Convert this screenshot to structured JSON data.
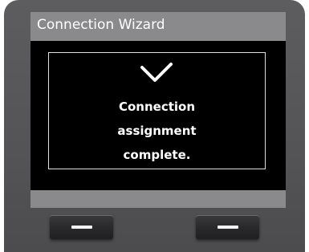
{
  "header": {
    "title": "Connection Wizard"
  },
  "message": {
    "icon": "checkmark-icon",
    "lines": [
      "Connection",
      "assignment",
      "complete."
    ]
  },
  "softkeys": {
    "left_icon": "dash-icon",
    "right_icon": "dash-icon"
  },
  "colors": {
    "housing": "#545456",
    "screen_chrome": "#8a8a8c",
    "content_bg": "#000000",
    "text": "#ffffff"
  }
}
